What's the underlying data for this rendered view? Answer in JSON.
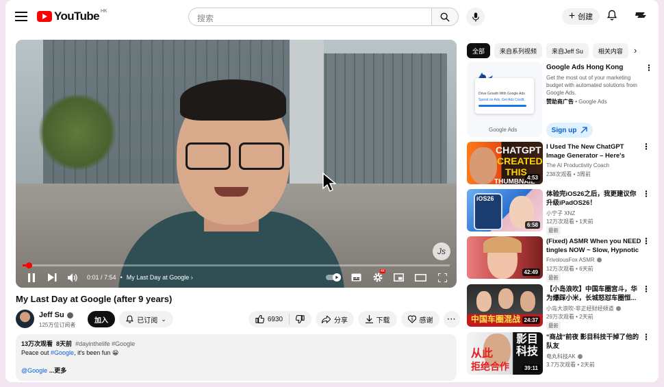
{
  "header": {
    "logo_text": "YouTube",
    "region": "HK",
    "search_placeholder": "搜索",
    "create_label": "创建"
  },
  "player": {
    "time_current": "0:01",
    "time_total": "7:54",
    "chapter": "My Last Day at Google",
    "progress": 0.003,
    "hd_badge": "4K"
  },
  "video": {
    "title": "My Last Day at Google (after 9 years)",
    "channel": "Jeff Su",
    "subscribers": "125万位订阅者",
    "join_label": "加入",
    "subscribe_label": "已订阅",
    "likes": "6930",
    "share_label": "分享",
    "download_label": "下载",
    "thanks_label": "感谢"
  },
  "description": {
    "views": "13万次观看",
    "age": "8天前",
    "tags": "#dayinthelife #Google",
    "line1_prefix": "Peace out ",
    "line1_tag": "#Google",
    "line1_suffix": ", it's been fun 😀",
    "mention": "@Google",
    "more": "...更多"
  },
  "chips": [
    "全部",
    "来自系列视频",
    "来自Jeff Su",
    "相关内容"
  ],
  "ad": {
    "title": "Google Ads Hong Kong",
    "text": "Get the most out of your marketing budget with automated solutions from Google Ads.",
    "sponsor_label": "赞助商广告",
    "sponsor_name": "Google Ads",
    "card_title": "Drive Growth With Google Ads",
    "card_sub": "Spend on Ads. Get Ads Credit.",
    "logo_text": "Google Ads",
    "signup_label": "Sign up"
  },
  "recommendations": [
    {
      "title": "I Used The New ChatGPT Image Generator – Here's What...",
      "channel": "The AI Productivity Coach",
      "verified": false,
      "meta": "238次观看 • 3周前",
      "badge": "",
      "duration": "4:53",
      "thumb_text": [
        "CHATGPT",
        "CREATED",
        "THIS",
        "THUMBNAIL"
      ]
    },
    {
      "title": "体验完iOS26之后，我更建议你升级iPadOS26！",
      "channel": "小宁子 XNZ",
      "verified": false,
      "meta": "12万次观看 • 1天前",
      "badge": "最新",
      "duration": "6:58",
      "thumb_text": [
        "iOS26"
      ]
    },
    {
      "title": "(Fixed) ASMR When you NEED tingles NOW ~ Slow, Hypnotic ...",
      "channel": "FrivolousFox ASMR",
      "verified": true,
      "meta": "12万次观看 • 6天前",
      "badge": "最新",
      "duration": "42:49",
      "thumb_text": []
    },
    {
      "title": "【小岛浪吹】中国车圈宫斗，华为爆踩小米，长城怒怼车圈恒...",
      "channel": "小岛大浪吹-非正经财经频道",
      "verified": true,
      "meta": "29万次观看 • 2天前",
      "badge": "最新",
      "duration": "24:37",
      "thumb_text": [
        "中国车圈混战"
      ]
    },
    {
      "title": "\"商战\"前夜 影目科技干掉了他的队友",
      "channel": "电丸科技AK",
      "verified": true,
      "meta": "3.7万次观看 • 2天前",
      "badge": "",
      "duration": "39:11",
      "thumb_text": [
        "影目",
        "科技",
        "从此",
        "拒绝合作"
      ]
    }
  ],
  "colors": {
    "accent": "#ff0000",
    "link": "#065fd4"
  }
}
